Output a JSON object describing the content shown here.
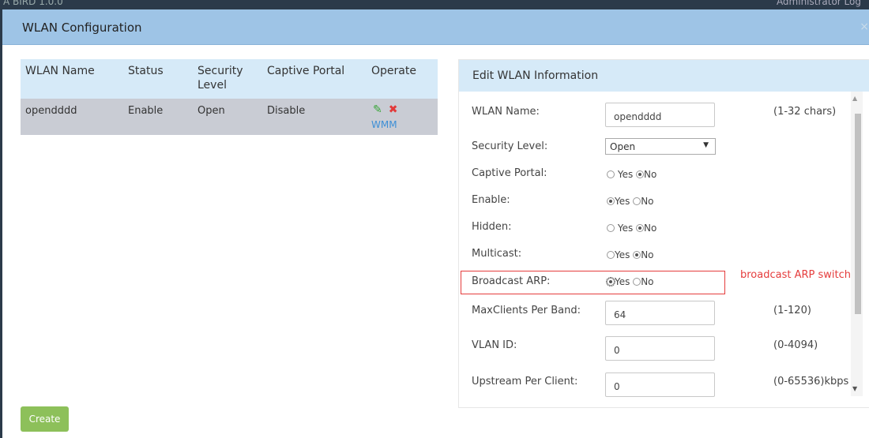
{
  "header": {
    "strip_left": "A BIRD 1.0.0",
    "strip_right": "Administrator  Log",
    "title": "WLAN Configuration",
    "close": "×"
  },
  "list": {
    "columns": [
      "WLAN Name",
      "Status",
      "Security Level",
      "Captive Portal",
      "Operate"
    ],
    "rows": [
      {
        "name": "opendddd",
        "status": "Enable",
        "security": "Open",
        "portal": "Disable",
        "edit_icon": "pencil-icon",
        "delete_icon": "x-icon",
        "extra": "WMM"
      }
    ]
  },
  "create_label": "Create",
  "edit": {
    "title": "Edit WLAN Information",
    "fields": {
      "wlan_name_label": "WLAN Name:",
      "wlan_name_value": "opendddd",
      "wlan_name_hint": "(1-32 chars)",
      "security_label": "Security Level:",
      "security_value": "Open",
      "captive_label": "Captive Portal:",
      "enable_label": "Enable:",
      "hidden_label": "Hidden:",
      "multicast_label": "Multicast:",
      "arp_label": "Broadcast ARP:",
      "maxclients_label": "MaxClients Per Band:",
      "maxclients_value": "64",
      "maxclients_hint": "(1-120)",
      "vlan_label": "VLAN ID:",
      "vlan_value": "0",
      "vlan_hint": "(0-4094)",
      "upstream_label": "Upstream Per Client:",
      "upstream_value": "0",
      "upstream_hint": "(0-65536)kbps"
    },
    "radios": {
      "yes": "Yes",
      "no": "No",
      "captive": "No",
      "enable": "Yes",
      "hidden": "No",
      "multicast": "No",
      "arp": "Yes"
    },
    "annotation": "broadcast ARP switch"
  },
  "colors": {
    "header_bg": "#9ec4e6",
    "annotation": "#e53c3c",
    "create_btn": "#8dc05a"
  }
}
